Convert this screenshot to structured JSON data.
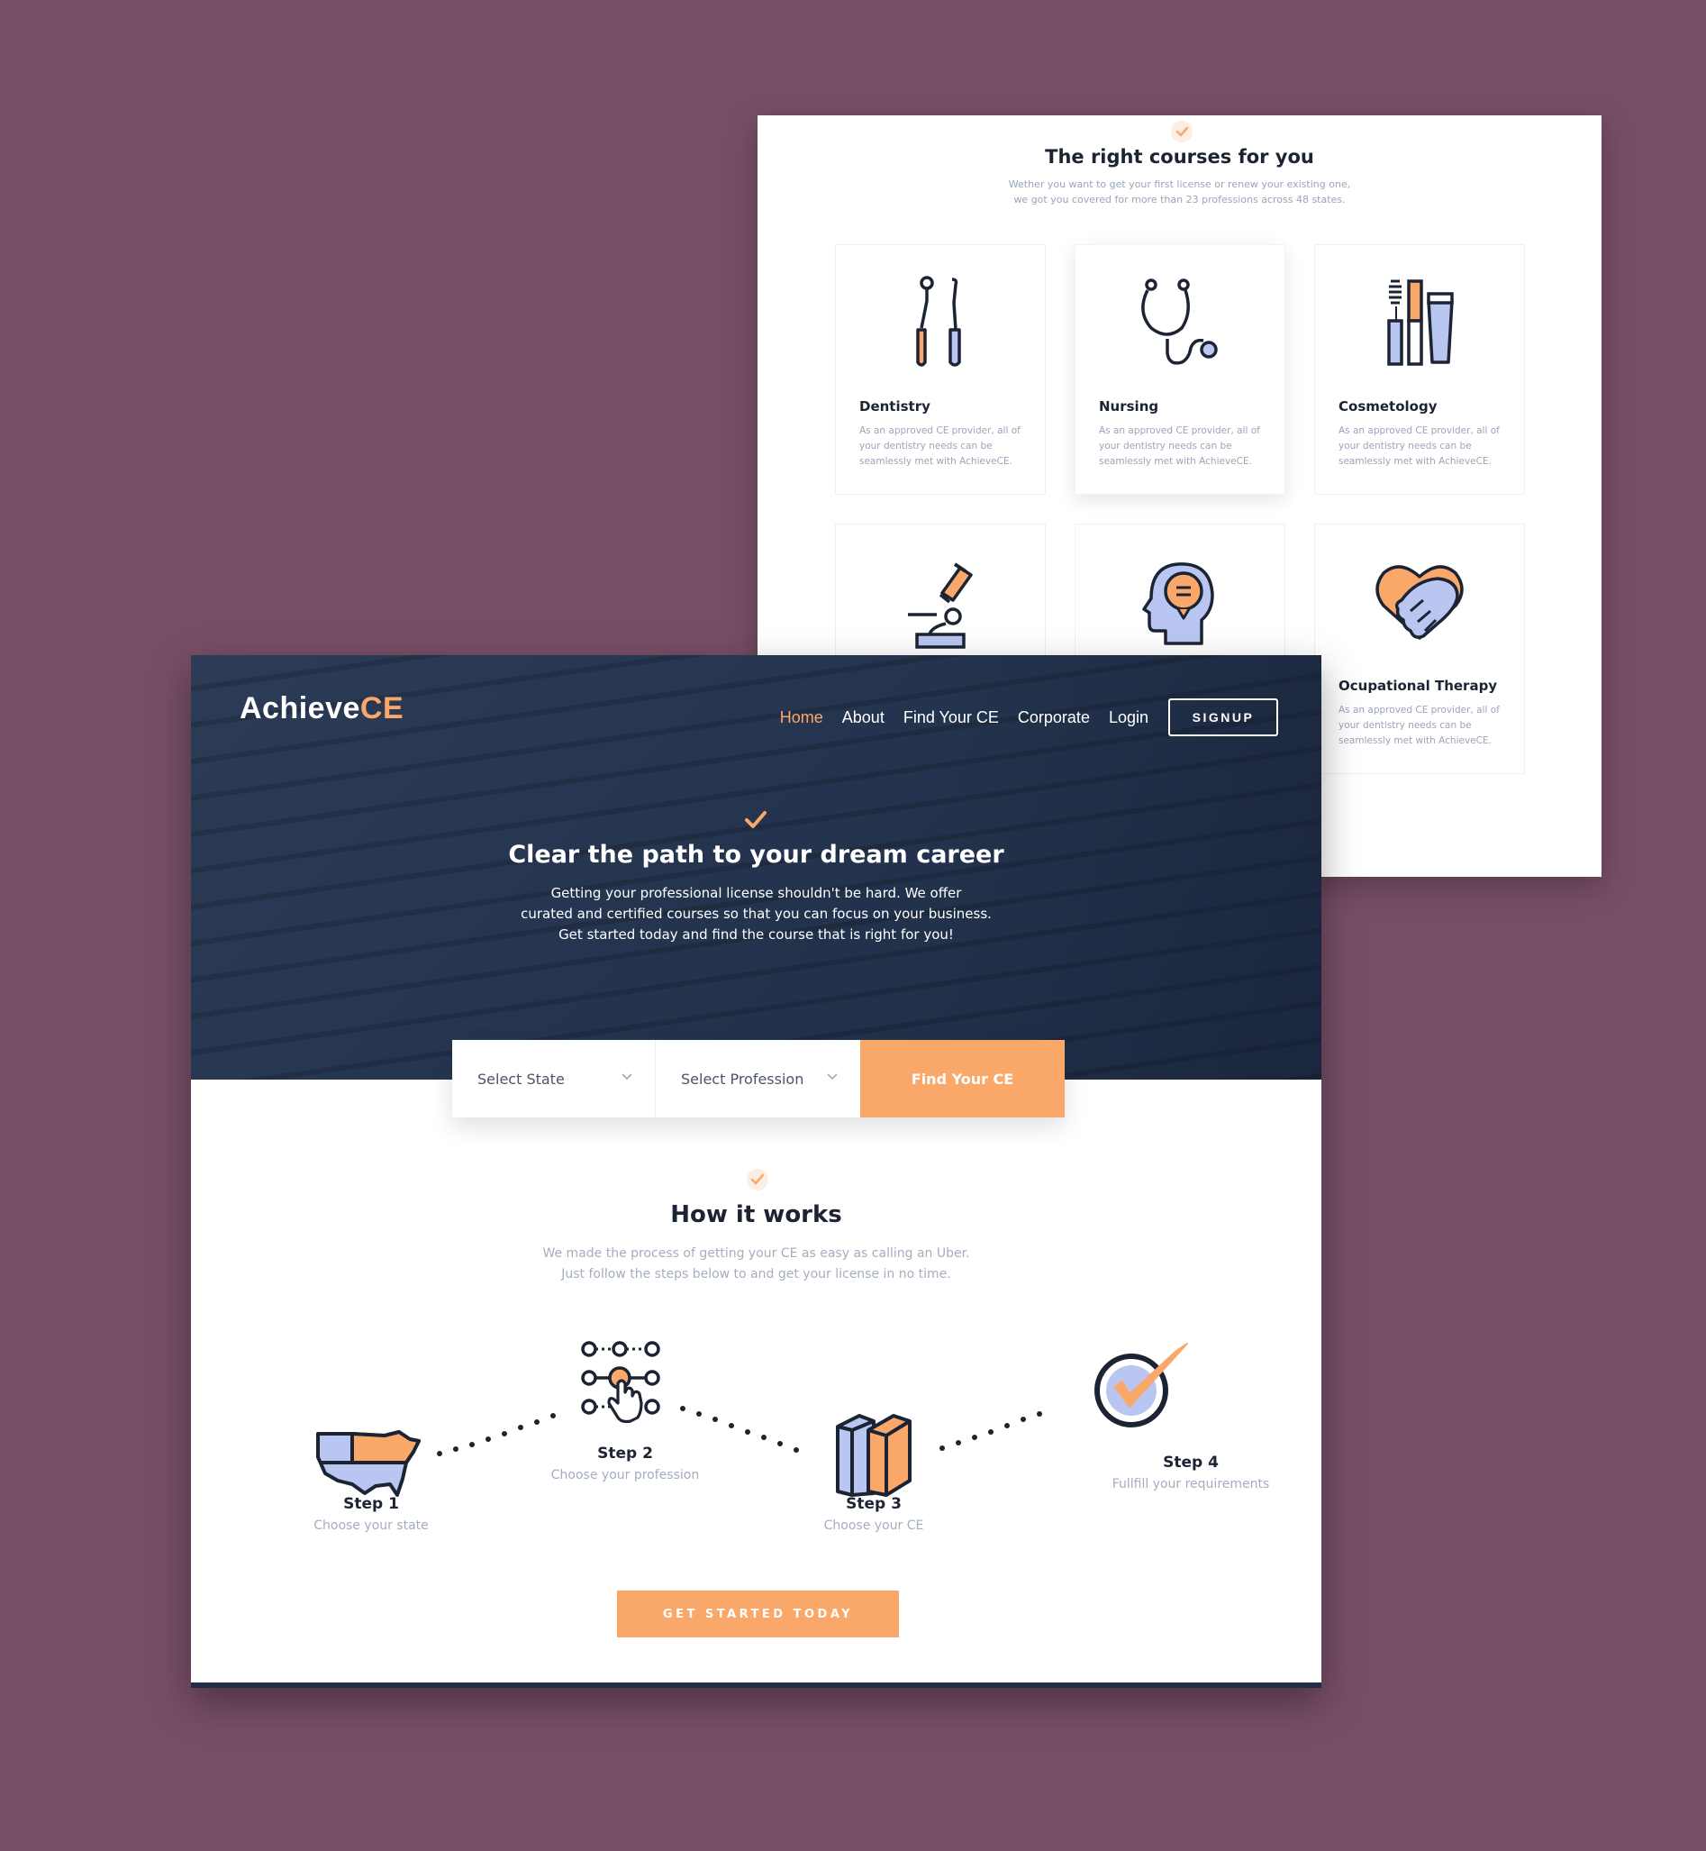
{
  "courses": {
    "title": "The right courses for you",
    "subtitle_line1": "Wether you want to get your first license or renew your existing one,",
    "subtitle_line2": "we got you covered for more than 23 professions across 48 states.",
    "cards": [
      {
        "title": "Dentistry",
        "icon": "dental-tools-icon",
        "desc": "As an approved CE provider, all of your dentistry needs can be seamlessly met with AchieveCE."
      },
      {
        "title": "Nursing",
        "icon": "stethoscope-icon",
        "desc": "As an approved CE provider, all of your dentistry needs can be seamlessly met with AchieveCE."
      },
      {
        "title": "Cosmetology",
        "icon": "cosmetics-icon",
        "desc": "As an approved CE provider, all of your dentistry needs can be seamlessly met with AchieveCE."
      },
      {
        "title": "",
        "icon": "microscope-icon",
        "desc": ""
      },
      {
        "title": "",
        "icon": "head-speech-icon",
        "desc": ""
      },
      {
        "title": "Ocupational Therapy",
        "icon": "heart-handshake-icon",
        "desc": "As an approved CE provider, all of your dentistry needs can be seamlessly met with AchieveCE."
      }
    ]
  },
  "header": {
    "logo_main": "Achieve",
    "logo_accent": "CE",
    "nav": [
      "Home",
      "About",
      "Find Your CE",
      "Corporate",
      "Login"
    ],
    "signup": "SIGNUP"
  },
  "hero": {
    "title": "Clear the path to your dream career",
    "line1": "Getting your professional license shouldn't be hard. We offer",
    "line2": "curated and certified courses so that you can focus on your business.",
    "line3": "Get started today and find the course that is right for you!"
  },
  "search": {
    "state": "Select State",
    "profession": "Select Profession",
    "button": "Find Your CE"
  },
  "how": {
    "title": "How it works",
    "line1": "We made the process of getting your CE as easy as calling an Uber.",
    "line2": "Just follow the steps below to and get your license in no time.",
    "steps": [
      {
        "title": "Step 1",
        "desc": "Choose your state",
        "icon": "us-map-icon"
      },
      {
        "title": "Step 2",
        "desc": "Choose your profession",
        "icon": "network-select-icon"
      },
      {
        "title": "Step 3",
        "desc": "Choose your CE",
        "icon": "books-icon"
      },
      {
        "title": "Step 4",
        "desc": "Fullfill your requirements",
        "icon": "check-circle-icon"
      }
    ],
    "cta": "GET STARTED TODAY"
  },
  "colors": {
    "accent": "#f9a86a",
    "navy": "#1c2434",
    "background": "#774e66",
    "icon_blue": "#b9c6f2"
  }
}
